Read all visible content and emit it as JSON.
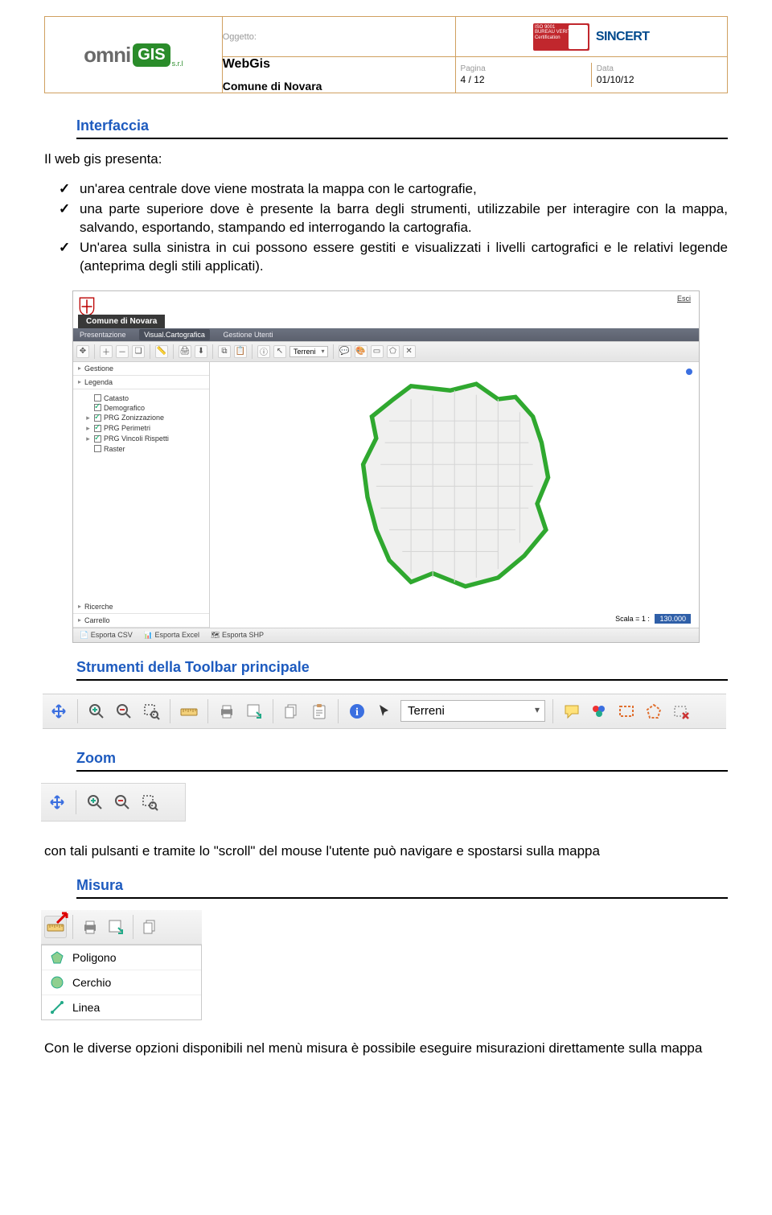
{
  "header": {
    "oggetto_label": "Oggetto:",
    "line1": "WebGis",
    "line2": "Comune di Novara",
    "pagina_label": "Pagina",
    "pagina_value": "4 / 12",
    "data_label": "Data",
    "data_value": "01/10/12",
    "logo_omni": "omni",
    "logo_gis": "GIS",
    "logo_srl": "s.r.l",
    "bv_text": "ISO 9001\nBUREAU VERITAS\nCertification",
    "sincert": "SINCERT"
  },
  "sections": {
    "interfaccia": "Interfaccia",
    "strumenti": "Strumenti della Toolbar principale",
    "zoom": "Zoom",
    "misura": "Misura"
  },
  "text": {
    "intro": "Il web gis presenta:",
    "b1": "un'area centrale dove viene mostrata la mappa con le cartografie,",
    "b2": "una parte superiore dove è presente la barra degli strumenti, utilizzabile per interagire con la mappa, salvando, esportando, stampando ed interrogando la cartografia.",
    "b3": "Un'area sulla sinistra in cui possono essere gestiti e visualizzati i livelli cartografici e le relativi legende (anteprima degli stili applicati).",
    "zoom_para": "con tali pulsanti e tramite lo \"scroll\" del mouse l'utente può navigare e spostarsi sulla mappa",
    "misura_para": "Con le diverse opzioni disponibili nel menù misura è possibile eseguire misurazioni direttamente sulla mappa"
  },
  "app": {
    "exit": "Esci",
    "title": "Comune di Novara",
    "menu": {
      "a": "Presentazione",
      "b": "Visual.Cartografica",
      "c": "Gestione Utenti"
    },
    "toolbar_combo": "Terreni",
    "side": {
      "gestione": "Gestione",
      "legenda": "Legenda",
      "layers": [
        {
          "label": "Catasto",
          "checked": false,
          "expandable": false
        },
        {
          "label": "Demografico",
          "checked": true,
          "expandable": false
        },
        {
          "label": "PRG Zonizzazione",
          "checked": true,
          "expandable": true
        },
        {
          "label": "PRG Perimetri",
          "checked": true,
          "expandable": true
        },
        {
          "label": "PRG Vincoli Rispetti",
          "checked": true,
          "expandable": true
        },
        {
          "label": "Raster",
          "checked": false,
          "expandable": false
        }
      ],
      "ricerche": "Ricerche",
      "carrello": "Carrello"
    },
    "scale_label": "Scala = 1 :",
    "scale_value": "130.000",
    "footer": {
      "csv": "Esporta CSV",
      "xls": "Esporta Excel",
      "shp": "Esporta SHP"
    }
  },
  "toolbar_big": {
    "combo": "Terreni"
  },
  "misura_menu": {
    "poligono": "Poligono",
    "cerchio": "Cerchio",
    "linea": "Linea"
  }
}
